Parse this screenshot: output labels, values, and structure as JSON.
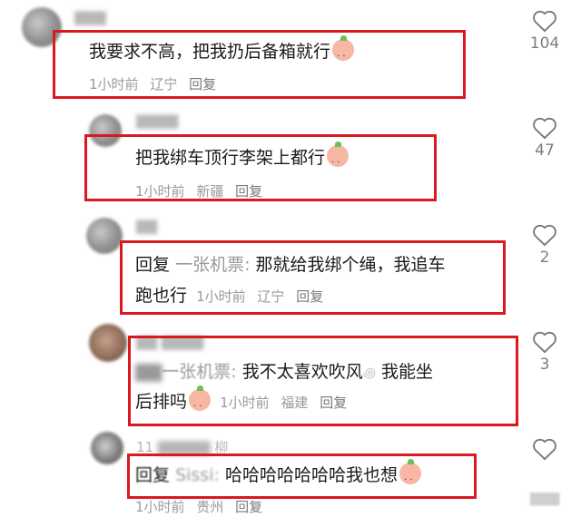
{
  "comments": [
    {
      "text": "我要求不高，把我扔后备箱就行",
      "time": "1小时前",
      "location": "辽宁",
      "reply": "回复",
      "likes": "104"
    },
    {
      "text": "把我绑车顶行李架上都行",
      "time": "1小时前",
      "location": "新疆",
      "reply": "回复",
      "likes": "47"
    },
    {
      "reply_prefix": "回复",
      "reply_target": "一张机票:",
      "text_line1": "那就给我绑个绳，我追车",
      "text_line2": "跑也行",
      "time": "1小时前",
      "location": "辽宁",
      "reply": "回复",
      "likes": "2"
    },
    {
      "username": "一张机票:",
      "text_line1": "我不太喜欢吹风",
      "text_line1b": "我能坐",
      "text_line2": "后排吗",
      "time": "1小时前",
      "location": "福建",
      "reply": "回复",
      "likes": "3"
    },
    {
      "username": "11",
      "username_tail": "柳",
      "reply_prefix": "回复",
      "reply_target": "Sissi:",
      "text": "哈哈哈哈哈哈哈我也想",
      "time": "1小时前",
      "location": "贵州",
      "reply": "回复"
    }
  ],
  "colors": {
    "highlight": "#d9191f",
    "meta": "#9a9a9a"
  },
  "icons": {
    "like": "heart-outline-icon",
    "emoji": "peach-emoji-icon"
  }
}
